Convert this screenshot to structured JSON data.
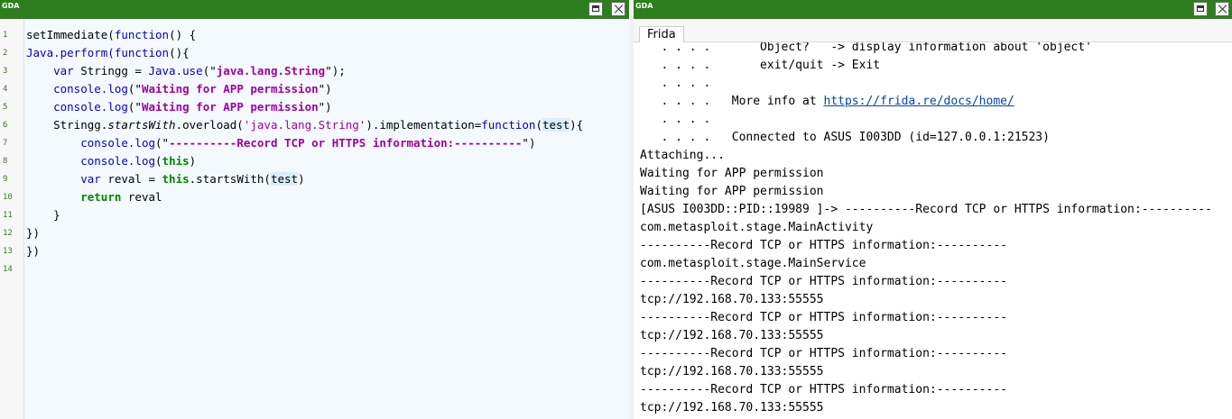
{
  "app_logo": "GDA",
  "editor": {
    "lines": [
      {
        "n": "1",
        "segs": [
          {
            "t": "setImmediate(",
            "c": ""
          },
          {
            "t": "function",
            "c": "kw"
          },
          {
            "t": "() {",
            "c": ""
          }
        ]
      },
      {
        "n": "2",
        "segs": [
          {
            "t": "Java.perform(",
            "c": "kw"
          },
          {
            "t": "function",
            "c": "kw"
          },
          {
            "t": "(){",
            "c": ""
          }
        ]
      },
      {
        "n": "3",
        "segs": [
          {
            "t": "    ",
            "c": ""
          },
          {
            "t": "var",
            "c": "kw"
          },
          {
            "t": " Stringg = ",
            "c": ""
          },
          {
            "t": "Java.use",
            "c": "kw"
          },
          {
            "t": "(\"",
            "c": ""
          },
          {
            "t": "java.lang.String",
            "c": "str"
          },
          {
            "t": "\");",
            "c": ""
          }
        ]
      },
      {
        "n": "4",
        "segs": [
          {
            "t": "    ",
            "c": ""
          },
          {
            "t": "console.log",
            "c": "kw"
          },
          {
            "t": "(\"",
            "c": ""
          },
          {
            "t": "Waiting for APP permission",
            "c": "str"
          },
          {
            "t": "\")",
            "c": ""
          }
        ]
      },
      {
        "n": "5",
        "segs": [
          {
            "t": "    ",
            "c": ""
          },
          {
            "t": "console.log",
            "c": "kw"
          },
          {
            "t": "(\"",
            "c": ""
          },
          {
            "t": "Waiting for APP permission",
            "c": "str"
          },
          {
            "t": "\")",
            "c": ""
          }
        ]
      },
      {
        "n": "6",
        "segs": [
          {
            "t": "    Stringg.",
            "c": ""
          },
          {
            "t": "startsWith",
            "c": "it"
          },
          {
            "t": ".overload(",
            "c": ""
          },
          {
            "t": "'java.lang.String'",
            "c": "str2"
          },
          {
            "t": ").implementation=",
            "c": ""
          },
          {
            "t": "function",
            "c": "kw"
          },
          {
            "t": "(",
            "c": ""
          },
          {
            "t": "test",
            "c": "hl"
          },
          {
            "t": "){",
            "c": ""
          }
        ]
      },
      {
        "n": "7",
        "segs": [
          {
            "t": "        ",
            "c": ""
          },
          {
            "t": "console.log",
            "c": "kw"
          },
          {
            "t": "(\"",
            "c": ""
          },
          {
            "t": "----------Record TCP or HTTPS information:----------",
            "c": "str"
          },
          {
            "t": "\")",
            "c": ""
          }
        ]
      },
      {
        "n": "8",
        "segs": [
          {
            "t": "        ",
            "c": ""
          },
          {
            "t": "console.log",
            "c": "kw"
          },
          {
            "t": "(",
            "c": ""
          },
          {
            "t": "this",
            "c": "kwb"
          },
          {
            "t": ")",
            "c": ""
          }
        ]
      },
      {
        "n": "9",
        "segs": [
          {
            "t": "        ",
            "c": ""
          },
          {
            "t": "var",
            "c": "kw"
          },
          {
            "t": " reval = ",
            "c": ""
          },
          {
            "t": "this",
            "c": "kwb"
          },
          {
            "t": ".startsWith(",
            "c": ""
          },
          {
            "t": "test",
            "c": "hl"
          },
          {
            "t": ")",
            "c": ""
          }
        ]
      },
      {
        "n": "10",
        "segs": [
          {
            "t": "        ",
            "c": ""
          },
          {
            "t": "return",
            "c": "kwb"
          },
          {
            "t": " reval",
            "c": ""
          }
        ]
      },
      {
        "n": "11",
        "segs": [
          {
            "t": "    }",
            "c": ""
          }
        ]
      },
      {
        "n": "12",
        "segs": [
          {
            "t": "})",
            "c": ""
          }
        ]
      },
      {
        "n": "13",
        "segs": [
          {
            "t": "})",
            "c": ""
          }
        ]
      },
      {
        "n": "14",
        "segs": [
          {
            "t": "",
            "c": ""
          }
        ]
      }
    ]
  },
  "console": {
    "tab_label": "Frida",
    "lines": [
      {
        "t": "   . . . .       Object?   -> display information about 'object'"
      },
      {
        "t": "   . . . .       exit/quit -> Exit"
      },
      {
        "t": "   . . . ."
      },
      {
        "t": "   . . . .   More info at ",
        "link": "https://frida.re/docs/home/"
      },
      {
        "t": "   . . . ."
      },
      {
        "t": "   . . . .   Connected to ASUS I003DD (id=127.0.0.1:21523)"
      },
      {
        "t": "Attaching..."
      },
      {
        "t": "Waiting for APP permission"
      },
      {
        "t": "Waiting for APP permission"
      },
      {
        "t": "[ASUS I003DD::PID::19989 ]-> ----------Record TCP or HTTPS information:----------"
      },
      {
        "t": "com.metasploit.stage.MainActivity"
      },
      {
        "t": "----------Record TCP or HTTPS information:----------"
      },
      {
        "t": "com.metasploit.stage.MainService"
      },
      {
        "t": "----------Record TCP or HTTPS information:----------"
      },
      {
        "t": "tcp://192.168.70.133:55555"
      },
      {
        "t": "----------Record TCP or HTTPS information:----------"
      },
      {
        "t": "tcp://192.168.70.133:55555"
      },
      {
        "t": "----------Record TCP or HTTPS information:----------"
      },
      {
        "t": "tcp://192.168.70.133:55555"
      },
      {
        "t": "----------Record TCP or HTTPS information:----------"
      },
      {
        "t": "tcp://192.168.70.133:55555"
      }
    ]
  }
}
